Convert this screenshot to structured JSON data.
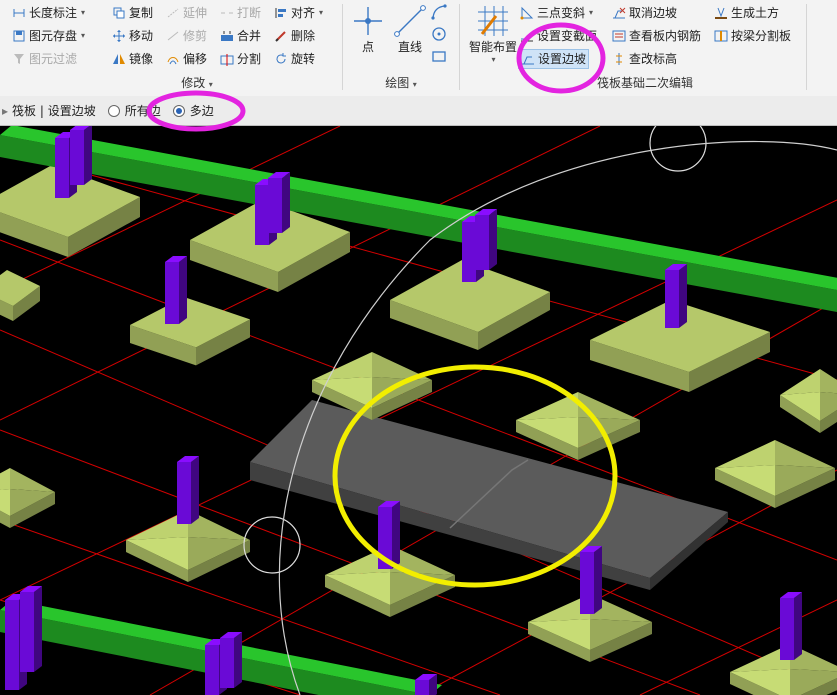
{
  "ribbon": {
    "edit_group": {
      "title": "修改",
      "left_items": [
        {
          "label": "长度标注",
          "icon": "length-dimension-icon",
          "has_menu": true,
          "disabled": false
        },
        {
          "label": "图元存盘",
          "icon": "save-element-icon",
          "has_menu": true,
          "disabled": false
        },
        {
          "label": "图元过滤",
          "icon": "filter-icon",
          "has_menu": false,
          "disabled": true
        }
      ],
      "col1": [
        {
          "label": "复制",
          "icon": "copy-icon",
          "disabled": false
        },
        {
          "label": "移动",
          "icon": "move-icon",
          "disabled": false
        },
        {
          "label": "镜像",
          "icon": "mirror-icon",
          "disabled": false
        }
      ],
      "col2": [
        {
          "label": "延伸",
          "icon": "extend-icon",
          "disabled": true
        },
        {
          "label": "修剪",
          "icon": "trim-icon",
          "disabled": true
        },
        {
          "label": "偏移",
          "icon": "offset-icon",
          "disabled": false
        }
      ],
      "col3": [
        {
          "label": "打断",
          "icon": "break-icon",
          "disabled": true
        },
        {
          "label": "合并",
          "icon": "merge-icon",
          "disabled": false
        },
        {
          "label": "分割",
          "icon": "split-icon",
          "disabled": false
        }
      ],
      "col4": [
        {
          "label": "对齐",
          "icon": "align-icon",
          "has_menu": true,
          "disabled": false
        },
        {
          "label": "删除",
          "icon": "delete-icon",
          "disabled": false
        },
        {
          "label": "旋转",
          "icon": "rotate-icon",
          "disabled": false
        }
      ]
    },
    "draw_group": {
      "title": "绘图",
      "point_label": "点",
      "line_label": "直线"
    },
    "raft_group": {
      "title": "筏板基础二次编辑",
      "smart_label": "智能布置",
      "col1": [
        {
          "label": "三点变斜",
          "icon": "three-point-slope-icon",
          "has_menu": true
        },
        {
          "label": "设置变截面",
          "icon": "variable-section-icon",
          "has_menu": false
        },
        {
          "label": "设置边坡",
          "icon": "set-slope-icon",
          "active": true
        }
      ],
      "col2": [
        {
          "label": "取消边坡",
          "icon": "cancel-slope-icon"
        },
        {
          "label": "查看板内钢筋",
          "icon": "view-rebar-icon"
        },
        {
          "label": "查改标高",
          "icon": "edit-elevation-icon"
        }
      ],
      "col3": [
        {
          "label": "生成土方",
          "icon": "earthwork-icon"
        },
        {
          "label": "按梁分割板",
          "icon": "split-by-beam-icon"
        }
      ]
    }
  },
  "subbar": {
    "breadcrumb": "筏板 | 设置边坡",
    "option_all": "所有边",
    "option_multi": "多边",
    "selected": "多边"
  },
  "colors": {
    "beam_green": "#29c52c",
    "footing": "#b5c86a",
    "column": "#6a0ad6",
    "raft": "#5b5b5b",
    "grid_red": "#d40000",
    "highlight_magenta": "#e324e0",
    "highlight_yellow": "#f2ee00"
  }
}
